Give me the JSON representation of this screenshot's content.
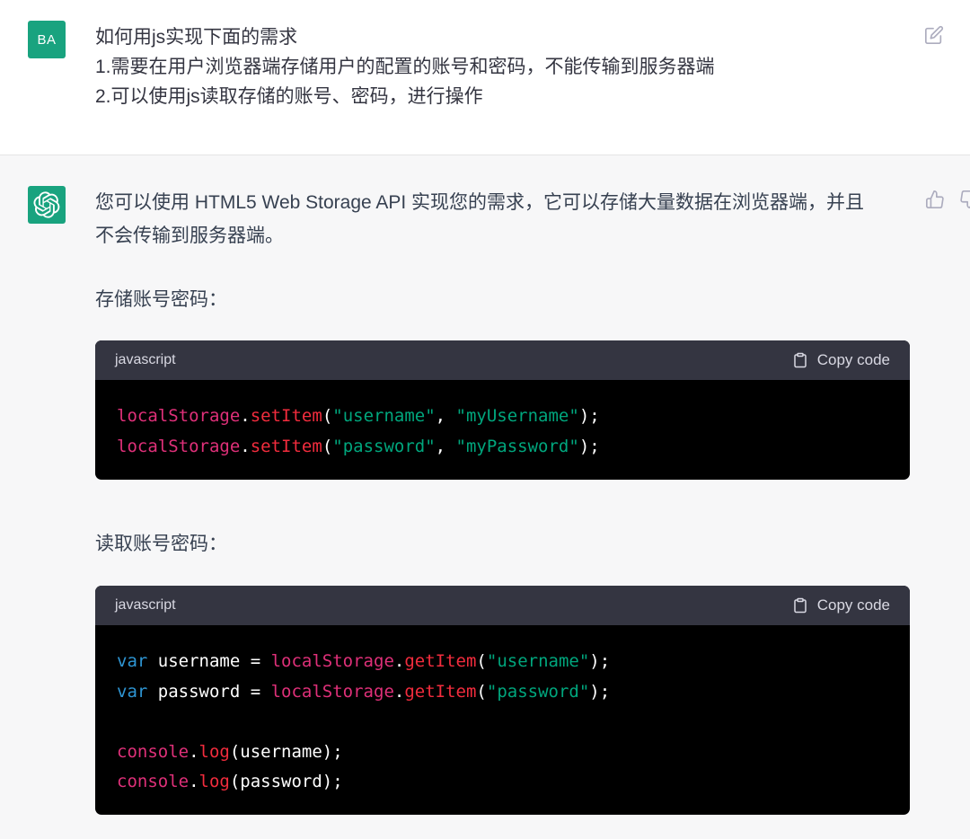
{
  "user_message": {
    "avatar_initials": "BA",
    "lines": [
      "如何用js实现下面的需求",
      "1.需要在用户浏览器端存储用户的配置的账号和密码，不能传输到服务器端",
      "2.可以使用js读取存储的账号、密码，进行操作"
    ],
    "edit_icon": "edit-icon"
  },
  "assistant_message": {
    "avatar_icon": "openai-logo-icon",
    "intro_line1": "您可以使用 HTML5 Web Storage API 实现您的需求，它可以存储大量数据在浏览器端，并且",
    "intro_line2": "不会传输到服务器端。",
    "store_label": "存储账号密码：",
    "read_label": "读取账号密码：",
    "feedback": {
      "thumbs_up": "thumbs-up-icon",
      "thumbs_down": "thumbs-down-icon"
    },
    "code_blocks": [
      {
        "language": "javascript",
        "copy_label": "Copy code",
        "lines": [
          [
            {
              "t": "localStorage",
              "c": "obj"
            },
            {
              "t": ".",
              "c": "plain"
            },
            {
              "t": "setItem",
              "c": "fn"
            },
            {
              "t": "(",
              "c": "plain"
            },
            {
              "t": "\"username\"",
              "c": "str"
            },
            {
              "t": ", ",
              "c": "plain"
            },
            {
              "t": "\"myUsername\"",
              "c": "str"
            },
            {
              "t": ");",
              "c": "plain"
            }
          ],
          [
            {
              "t": "localStorage",
              "c": "obj"
            },
            {
              "t": ".",
              "c": "plain"
            },
            {
              "t": "setItem",
              "c": "fn"
            },
            {
              "t": "(",
              "c": "plain"
            },
            {
              "t": "\"password\"",
              "c": "str"
            },
            {
              "t": ", ",
              "c": "plain"
            },
            {
              "t": "\"myPassword\"",
              "c": "str"
            },
            {
              "t": ");",
              "c": "plain"
            }
          ]
        ]
      },
      {
        "language": "javascript",
        "copy_label": "Copy code",
        "lines": [
          [
            {
              "t": "var",
              "c": "kw"
            },
            {
              "t": " username = ",
              "c": "plain"
            },
            {
              "t": "localStorage",
              "c": "obj"
            },
            {
              "t": ".",
              "c": "plain"
            },
            {
              "t": "getItem",
              "c": "fn"
            },
            {
              "t": "(",
              "c": "plain"
            },
            {
              "t": "\"username\"",
              "c": "str"
            },
            {
              "t": ");",
              "c": "plain"
            }
          ],
          [
            {
              "t": "var",
              "c": "kw"
            },
            {
              "t": " password = ",
              "c": "plain"
            },
            {
              "t": "localStorage",
              "c": "obj"
            },
            {
              "t": ".",
              "c": "plain"
            },
            {
              "t": "getItem",
              "c": "fn"
            },
            {
              "t": "(",
              "c": "plain"
            },
            {
              "t": "\"password\"",
              "c": "str"
            },
            {
              "t": ");",
              "c": "plain"
            }
          ],
          [],
          [
            {
              "t": "console",
              "c": "obj"
            },
            {
              "t": ".",
              "c": "plain"
            },
            {
              "t": "log",
              "c": "fn"
            },
            {
              "t": "(username);",
              "c": "plain"
            }
          ],
          [
            {
              "t": "console",
              "c": "obj"
            },
            {
              "t": ".",
              "c": "plain"
            },
            {
              "t": "log",
              "c": "fn"
            },
            {
              "t": "(password);",
              "c": "plain"
            }
          ]
        ]
      }
    ]
  },
  "colors": {
    "avatar_bg": "#19a37f",
    "code_header_bg": "#343541",
    "code_bg": "#000000",
    "token_object": "#df3079",
    "token_function": "#f22c3d",
    "token_string": "#00a67d",
    "token_keyword": "#2e95d3"
  }
}
